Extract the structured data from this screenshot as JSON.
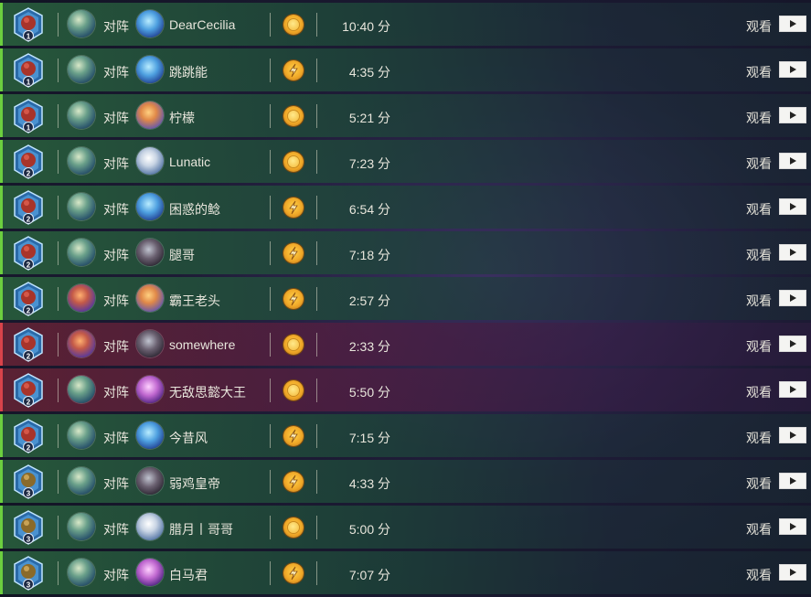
{
  "rows": [
    {
      "result": "win",
      "rank": "1",
      "rank_style": "red",
      "hero": "mage",
      "vs": "对阵",
      "opp_hero": "blue",
      "opponent": "DearCecilia",
      "coin": "gold",
      "duration": "10:40 分",
      "watch": "观看"
    },
    {
      "result": "win",
      "rank": "1",
      "rank_style": "red",
      "hero": "mage",
      "vs": "对阵",
      "opp_hero": "blue",
      "opponent": "跳跳能",
      "coin": "orange",
      "duration": "4:35 分",
      "watch": "观看"
    },
    {
      "result": "win",
      "rank": "1",
      "rank_style": "red",
      "hero": "mage",
      "vs": "对阵",
      "opp_hero": "orange",
      "opponent": "柠檬",
      "coin": "gold",
      "duration": "5:21 分",
      "watch": "观看"
    },
    {
      "result": "win",
      "rank": "2",
      "rank_style": "red",
      "hero": "mage",
      "vs": "对阵",
      "opp_hero": "white",
      "opponent": "Lunatic",
      "coin": "gold",
      "duration": "7:23 分",
      "watch": "观看"
    },
    {
      "result": "win",
      "rank": "2",
      "rank_style": "red",
      "hero": "mage",
      "vs": "对阵",
      "opp_hero": "blue",
      "opponent": "困惑的鲶",
      "coin": "orange",
      "duration": "6:54 分",
      "watch": "观看"
    },
    {
      "result": "win",
      "rank": "2",
      "rank_style": "red",
      "hero": "mage",
      "vs": "对阵",
      "opp_hero": "dark",
      "opponent": "腿哥",
      "coin": "orange",
      "duration": "7:18 分",
      "watch": "观看"
    },
    {
      "result": "win",
      "rank": "2",
      "rank_style": "red",
      "hero": "fire",
      "vs": "对阵",
      "opp_hero": "orange",
      "opponent": "霸王老头",
      "coin": "orange",
      "duration": "2:57 分",
      "watch": "观看"
    },
    {
      "result": "loss",
      "rank": "2",
      "rank_style": "red",
      "hero": "fire",
      "vs": "对阵",
      "opp_hero": "dark",
      "opponent": "somewhere",
      "coin": "gold",
      "duration": "2:33 分",
      "watch": "观看"
    },
    {
      "result": "loss",
      "rank": "2",
      "rank_style": "red",
      "hero": "mage",
      "vs": "对阵",
      "opp_hero": "purple",
      "opponent": "无敌思懿大王",
      "coin": "gold",
      "duration": "5:50 分",
      "watch": "观看"
    },
    {
      "result": "win",
      "rank": "2",
      "rank_style": "red",
      "hero": "mage",
      "vs": "对阵",
      "opp_hero": "blue",
      "opponent": "今昔风",
      "coin": "orange",
      "duration": "7:15 分",
      "watch": "观看"
    },
    {
      "result": "win",
      "rank": "3",
      "rank_style": "gold",
      "hero": "mage",
      "vs": "对阵",
      "opp_hero": "dark",
      "opponent": "弱鸡皇帝",
      "coin": "orange",
      "duration": "4:33 分",
      "watch": "观看"
    },
    {
      "result": "win",
      "rank": "3",
      "rank_style": "gold",
      "hero": "mage",
      "vs": "对阵",
      "opp_hero": "white",
      "opponent": "腊月丨哥哥",
      "coin": "gold",
      "duration": "5:00 分",
      "watch": "观看"
    },
    {
      "result": "win",
      "rank": "3",
      "rank_style": "gold",
      "hero": "mage",
      "vs": "对阵",
      "opp_hero": "purple",
      "opponent": "白马君",
      "coin": "orange",
      "duration": "7:07 分",
      "watch": "观看"
    }
  ],
  "colors": {
    "win_border": "#6ccf3f",
    "loss_border": "#d8434a",
    "coin": "#f0a828"
  }
}
